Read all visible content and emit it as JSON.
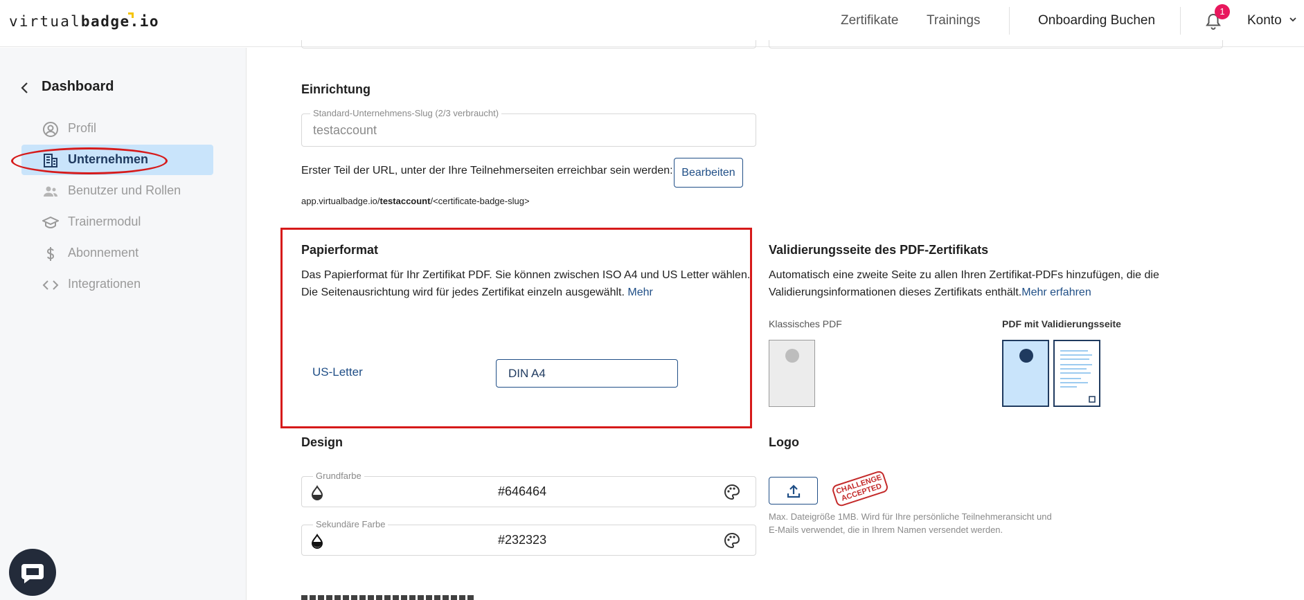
{
  "header": {
    "logo_light": "virtual",
    "logo_bold": "badge.io",
    "nav": [
      "Zertifikate",
      "Trainings"
    ],
    "onboarding": "Onboarding Buchen",
    "notification_count": "1",
    "account": "Konto"
  },
  "sidebar": {
    "back_label": "Dashboard",
    "items": [
      {
        "label": "Profil",
        "icon": "user-circle-icon"
      },
      {
        "label": "Unternehmen",
        "icon": "building-icon"
      },
      {
        "label": "Benutzer und Rollen",
        "icon": "users-icon"
      },
      {
        "label": "Trainermodul",
        "icon": "graduation-cap-icon"
      },
      {
        "label": "Abonnement",
        "icon": "dollar-icon"
      },
      {
        "label": "Integrationen",
        "icon": "code-icon"
      }
    ],
    "active_index": 1
  },
  "setup": {
    "title": "Einrichtung",
    "slug_label": "Standard-Unternehmens-Slug (2/3 verbraucht)",
    "slug_value": "testaccount",
    "url_text": "Erster Teil der URL, unter der Ihre Teilnehmerseiten erreichbar sein werden:",
    "edit_button": "Bearbeiten",
    "url_prefix": "app.virtualbadge.io/",
    "url_slug": "testaccount",
    "url_suffix": "/<certificate-badge-slug>"
  },
  "paper": {
    "title": "Papierformat",
    "desc_1": "Das Papierformat für Ihr Zertifikat PDF. Sie können zwischen ISO A4 und US Letter wählen.",
    "desc_2": "Die Seitenausrichtung wird für jedes Zertifikat einzeln ausgewählt.",
    "more": "Mehr",
    "option_letter": "US-Letter",
    "option_a4": "DIN A4"
  },
  "validation": {
    "title": "Validierungsseite des PDF-Zertifikats",
    "desc_1": "Automatisch eine zweite Seite zu allen Ihren Zertifikat-PDFs hinzufügen, die die",
    "desc_2": "Validierungsinformationen dieses Zertifikats enthält.",
    "more": "Mehr erfahren",
    "classic_label": "Klassisches PDF",
    "with_page_label": "PDF mit Validierungsseite"
  },
  "design": {
    "title": "Design",
    "primary_label": "Grundfarbe",
    "primary_value": "#646464",
    "secondary_label": "Sekundäre Farbe",
    "secondary_value": "#232323"
  },
  "logo": {
    "title": "Logo",
    "stamp_1": "CHALLENGE",
    "stamp_2": "ACCEPTED",
    "hint": "Max. Dateigröße 1MB. Wird für Ihre persönliche Teilnehmeransicht und E-Mails verwendet, die in Ihrem Namen versendet werden."
  },
  "colors": {
    "accent": "#1f4e86",
    "active_bg": "#c9e4fb",
    "highlight": "#d61a1a",
    "badge": "#e8175d"
  }
}
